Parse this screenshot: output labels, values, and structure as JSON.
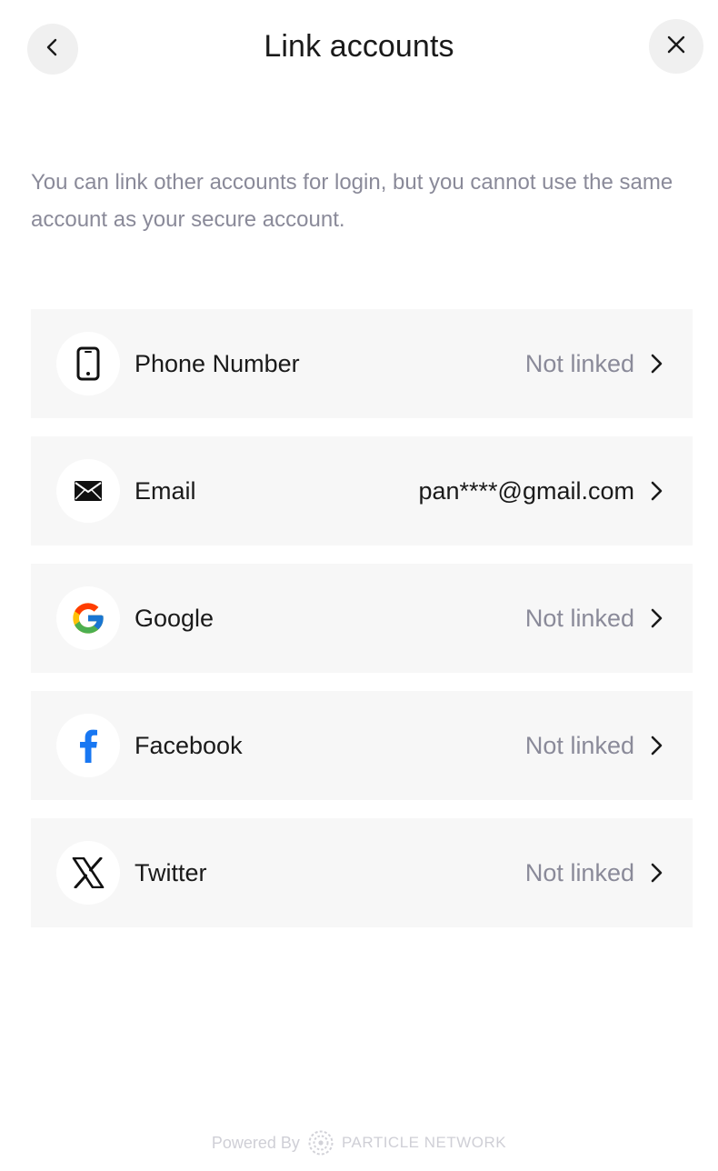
{
  "header": {
    "title": "Link accounts",
    "back_icon": "chevron-left-icon",
    "close_icon": "close-icon"
  },
  "description": "You can link other accounts for login, but you cannot use the same account as your secure account.",
  "accounts": [
    {
      "label": "Phone Number",
      "status": "Not linked",
      "icon": "phone-icon",
      "linked": false
    },
    {
      "label": "Email",
      "status": "pan****@gmail.com",
      "icon": "email-icon",
      "linked": true
    },
    {
      "label": "Google",
      "status": "Not linked",
      "icon": "google-icon",
      "linked": false
    },
    {
      "label": "Facebook",
      "status": "Not linked",
      "icon": "facebook-icon",
      "linked": false
    },
    {
      "label": "Twitter",
      "status": "Not linked",
      "icon": "x-twitter-icon",
      "linked": false
    }
  ],
  "footer": {
    "powered_by": "Powered By",
    "brand": "PARTICLE NETWORK",
    "logo_icon": "particle-network-logo"
  },
  "colors": {
    "row_background": "#f7f7f7",
    "muted_text": "#8a8a99",
    "facebook_blue": "#1877F2"
  }
}
